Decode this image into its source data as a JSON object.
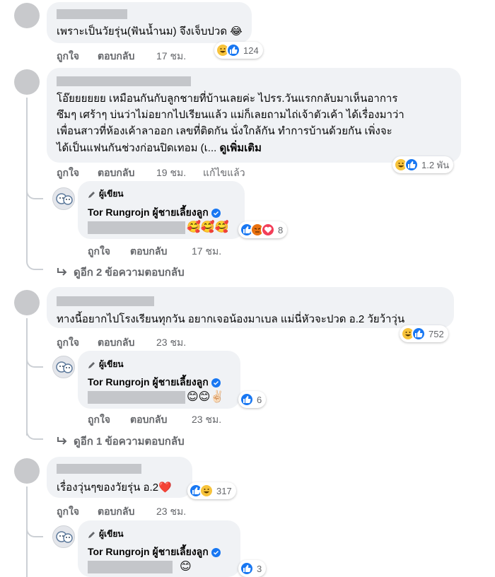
{
  "colors": {
    "like": "#1877f2",
    "haha": "#f7c33b",
    "love": "#f33e58",
    "angry": "#e9710f",
    "meta": "#65676b",
    "bubble": "#f0f2f5"
  },
  "comment1": {
    "text": "เพราะเป็นวัยรุ่น(ฟันน้ำนม) จึงเจ็บปวด 😂",
    "actions": {
      "like": "ถูกใจ",
      "reply": "ตอบกลับ",
      "time": "17 ชม."
    },
    "reactions": {
      "icons": [
        "haha-icon",
        "like-icon"
      ],
      "count": "124"
    }
  },
  "comment2": {
    "lines": [
      "โอ๊ยยยยยย เหมือนกันกับลูกชายที่บ้านเลยค่ะ ไปรร.วันแรกกลับมาเห็นอาการ",
      "ซึมๆ เศร้าๆ บ่นว่าไม่อยากไปเรียนแล้ว แม่ก็เลยถามไถ่เจ้าตัวเค้า ได้เรื่องมาว่า",
      "เพื่อนสาวที่ห้องเค้าลาออก เลขที่ติดกัน นั่งใกล้กัน ทำการบ้านด้วยกัน เพิ่งจะ",
      "ได้เป็นแฟนกันช่วงก่อนปิดเทอม (เ..."
    ],
    "see_more": "ดูเพิ่มเติม",
    "actions": {
      "like": "ถูกใจ",
      "reply": "ตอบกลับ",
      "time": "19 ชม.",
      "edited": "แก้ไขแล้ว"
    },
    "reactions": {
      "icons": [
        "haha-icon",
        "like-icon"
      ],
      "count": "1.2 พัน"
    },
    "reply": {
      "author_tag": "ผู้เขียน",
      "author_name": "Tor Rungrojn ผู้ชายเลี้ยงลูก",
      "emojis": "🥰🥰🥰",
      "actions": {
        "like": "ถูกใจ",
        "reply": "ตอบกลับ",
        "time": "17 ชม."
      },
      "reactions": {
        "icons": [
          "like-icon",
          "angry-icon",
          "love-icon"
        ],
        "count": "8"
      }
    },
    "more_replies": "ดูอีก 2 ข้อความตอบกลับ"
  },
  "comment3": {
    "text": "ทางนี้อยากไปโรงเรียนทุกวัน อยากเจอน้องมาเบล แม่นี่หัวจะปวด อ.2 วัยว้าวุ่น",
    "actions": {
      "like": "ถูกใจ",
      "reply": "ตอบกลับ",
      "time": "23 ชม."
    },
    "reactions": {
      "icons": [
        "haha-icon",
        "like-icon"
      ],
      "count": "752"
    },
    "reply": {
      "author_tag": "ผู้เขียน",
      "author_name": "Tor Rungrojn ผู้ชายเลี้ยงลูก",
      "emojis": "😊😊✌🏻",
      "actions": {
        "like": "ถูกใจ",
        "reply": "ตอบกลับ",
        "time": "23 ชม."
      },
      "reactions": {
        "icons": [
          "like-icon"
        ],
        "count": "6"
      }
    },
    "more_replies": "ดูอีก 1 ข้อความตอบกลับ"
  },
  "comment4": {
    "text": "เรื่องวุ่นๆของวัยรุ่น อ.2❤️",
    "actions": {
      "like": "ถูกใจ",
      "reply": "ตอบกลับ",
      "time": "23 ชม."
    },
    "reactions": {
      "icons": [
        "like-icon",
        "haha-icon"
      ],
      "count": "317"
    },
    "reply": {
      "author_tag": "ผู้เขียน",
      "author_name": "Tor Rungrojn ผู้ชายเลี้ยงลูก",
      "emojis": "😊",
      "reactions": {
        "icons": [
          "like-icon"
        ],
        "count": "3"
      }
    }
  }
}
